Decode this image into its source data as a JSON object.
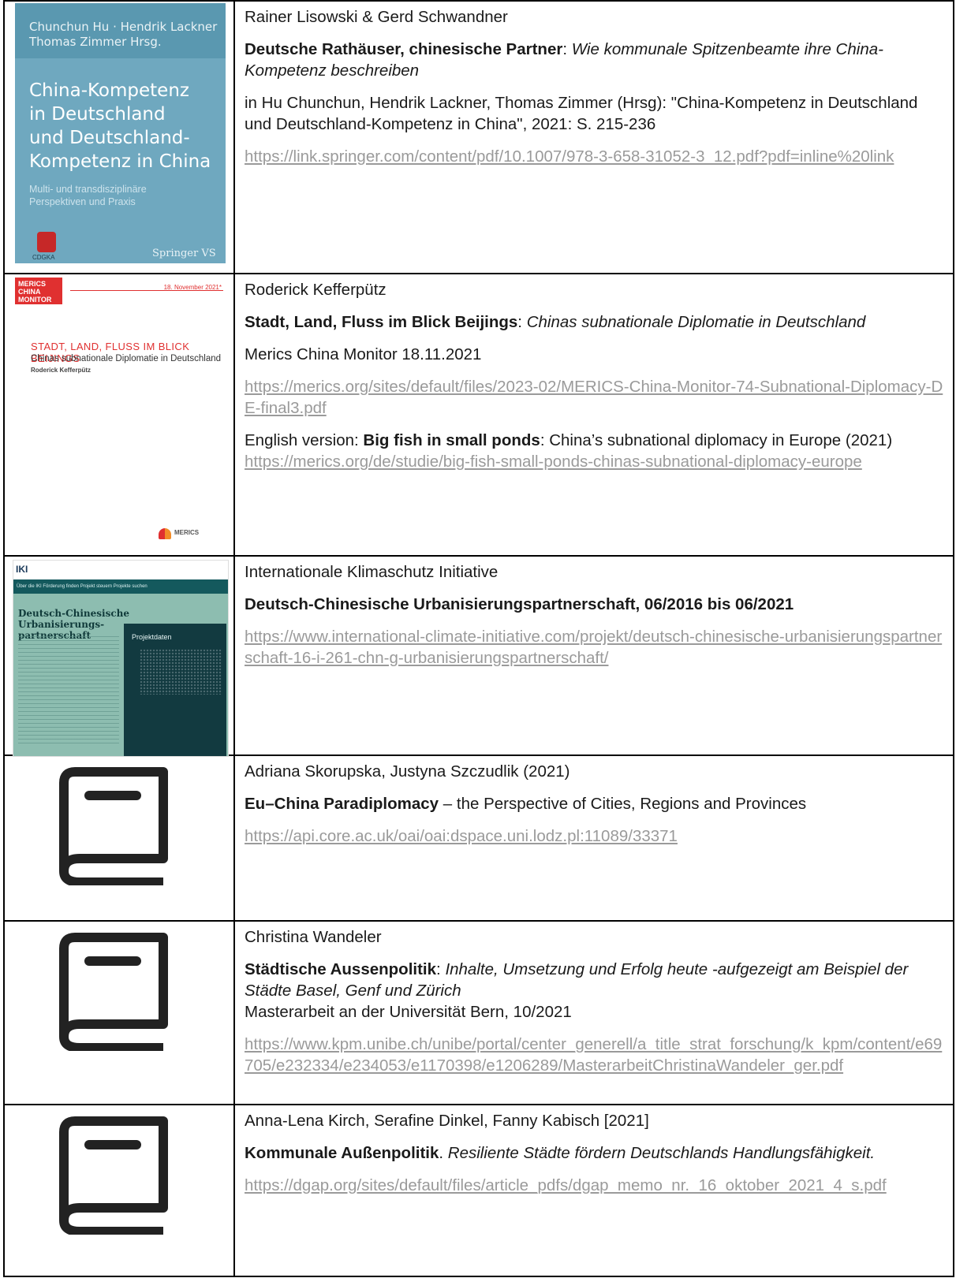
{
  "entries": [
    {
      "thumbnail": {
        "kind": "springer-book-cover",
        "editors": "Chunchun Hu · Hendrik Lackner",
        "editors2": "Thomas Zimmer  Hrsg.",
        "title_lines": [
          "China-Kompetenz",
          "in Deutschland",
          "und Deutschland-",
          "Kompetenz in China"
        ],
        "subtitle": "Multi- und transdisziplinäre Perspektiven und Praxis",
        "logo_text": "CDGKA",
        "publisher": "Springer VS"
      },
      "authors": "Rainer Lisowski & Gerd Schwandner",
      "title_bold": "Deutsche Rathäuser, chinesische Partner",
      "title_sep": ": ",
      "title_italic": "Wie kommunale Spitzenbeamte ihre China-Kompetenz beschreiben",
      "source": "in Hu Chunchun, Hendrik Lackner, Thomas Zimmer (Hrsg): \"China-Kompetenz in Deutschland und Deutschland-Kompetenz in China\", 2021: S. 215-236",
      "url": "https://link.springer.com/content/pdf/10.1007/978-3-658-31052-3_12.pdf?pdf=inline%20link"
    },
    {
      "thumbnail": {
        "kind": "merics-cover",
        "badge": "MERICS CHINA MONITOR",
        "date": "18. November 2021*",
        "title": "STADT, LAND, FLUSS IM BLICK BEIJINGS",
        "subtitle": "Chinas subnationale Diplomatie in Deutschland",
        "author": "Roderick Kefferpütz",
        "logo_text": "MERICS"
      },
      "authors": "Roderick Kefferpütz",
      "title_bold": "Stadt, Land, Fluss im Blick Beijings",
      "title_sep": ": ",
      "title_italic": "Chinas subnationale Diplomatie in Deutschland",
      "source": "Merics China Monitor 18.11.2021",
      "url": "https://merics.org/sites/default/files/2023-02/MERICS-China-Monitor-74-Subnational-Diplomacy-DE-final3.pdf",
      "extra_prefix": "English version: ",
      "extra_bold": "Big fish in small ponds",
      "extra_rest": ": China’s subnational diplomacy in Europe (2021)",
      "extra_url": "https://merics.org/de/studie/big-fish-small-ponds-chinas-subnational-diplomacy-europe"
    },
    {
      "thumbnail": {
        "kind": "iki-website",
        "logo": "IKI",
        "nav": "Über die IKI   Förderung finden   Projekt steuern   Projekte suchen",
        "heading": "Deutsch-Chinesische Urbanisierungs-partnerschaft",
        "panel_title": "Projektdaten"
      },
      "authors": "Internationale Klimaschutz Initiative",
      "title_bold": "Deutsch-Chinesische Urbanisierungspartnerschaft, 06/2016 bis 06/2021",
      "url": "https://www.international-climate-initiative.com/projekt/deutsch-chinesische-urbanisierungspartnerschaft-16-i-261-chn-g-urbanisierungspartnerschaft/"
    },
    {
      "thumbnail": {
        "kind": "book-icon"
      },
      "authors": "Adriana Skorupska, Justyna Szczudlik (2021)",
      "title_bold": "Eu–China Paradiplomacy",
      "title_rest": " – the Perspective of Cities, Regions and Provinces",
      "url": "https://api.core.ac.uk/oai/oai:dspace.uni.lodz.pl:11089/33371"
    },
    {
      "thumbnail": {
        "kind": "book-icon"
      },
      "authors": "Christina Wandeler",
      "title_bold": "Städtische Aussenpolitik",
      "title_sep": ": ",
      "title_italic": "Inhalte, Umsetzung und Erfolg heute -aufgezeigt am Beispiel der Städte Basel, Genf und Zürich",
      "source": "Masterarbeit an der Universität Bern, 10/2021",
      "url": "https://www.kpm.unibe.ch/unibe/portal/center_generell/a_title_strat_forschung/k_kpm/content/e69705/e232334/e234053/e1170398/e1206289/MasterarbeitChristinaWandeler_ger.pdf"
    },
    {
      "thumbnail": {
        "kind": "book-icon"
      },
      "authors": "Anna-Lena Kirch, Serafine Dinkel, Fanny Kabisch [2021]",
      "title_bold": "Kommunale Außenpolitik",
      "title_sep": ". ",
      "title_italic": "Resiliente Städte fördern Deutschlands Handlungsfähigkeit.",
      "url": "https://dgap.org/sites/default/files/article_pdfs/dgap_memo_nr._16_oktober_2021_4_s.pdf"
    }
  ]
}
